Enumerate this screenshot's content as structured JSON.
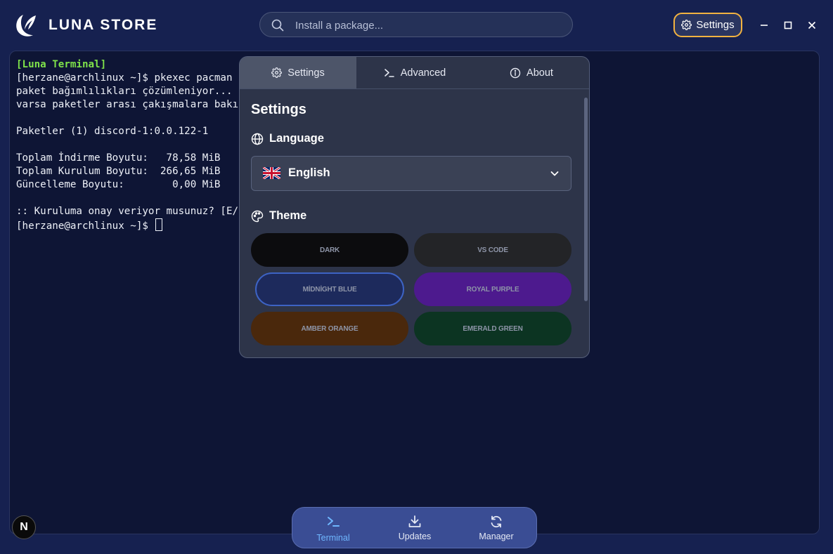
{
  "header": {
    "app_title": "LUNA STORE",
    "search_placeholder": "Install a package...",
    "settings_label": "Settings"
  },
  "terminal": {
    "lines": [
      {
        "text": "[Luna Terminal]",
        "highlight": true
      },
      {
        "text": "[herzane@archlinux ~]$ pkexec pacman -",
        "highlight": false
      },
      {
        "text": "paket bağımlılıkları çözümleniyor...",
        "highlight": false
      },
      {
        "text": "varsa paketler arası çakışmalara bakıl",
        "highlight": false
      },
      {
        "text": "",
        "highlight": false
      },
      {
        "text": "Paketler (1) discord-1:0.0.122-1",
        "highlight": false
      },
      {
        "text": "",
        "highlight": false
      },
      {
        "text": "Toplam İndirme Boyutu:   78,58 MiB",
        "highlight": false
      },
      {
        "text": "Toplam Kurulum Boyutu:  266,65 MiB",
        "highlight": false
      },
      {
        "text": "Güncelleme Boyutu:        0,00 MiB",
        "highlight": false
      },
      {
        "text": "",
        "highlight": false
      },
      {
        "text": ":: Kuruluma onay veriyor musunuz? [E/h",
        "highlight": false
      },
      {
        "text": "[herzane@archlinux ~]$ ",
        "highlight": false
      }
    ],
    "highlight_color": "#7fe24a"
  },
  "settings_panel": {
    "tabs": [
      {
        "label": "Settings",
        "icon": "gear-icon",
        "active": true
      },
      {
        "label": "Advanced",
        "icon": "terminal-prompt-icon",
        "active": false
      },
      {
        "label": "About",
        "icon": "info-icon",
        "active": false
      }
    ],
    "title": "Settings",
    "language_label": "Language",
    "language_value": "English",
    "language_flag": "uk-flag-icon",
    "theme_label": "Theme",
    "themes": [
      {
        "label": "DARK",
        "bg": "#0c0c0e",
        "border": "#0c0c0e"
      },
      {
        "label": "VS CODE",
        "bg": "#232427",
        "border": "#232427"
      },
      {
        "label": "MİDNİGHT BLUE",
        "bg": "#1d2a5c",
        "border": "#3d63c4",
        "selected": true
      },
      {
        "label": "ROYAL PURPLE",
        "bg": "#4d1a8e",
        "border": "#4d1a8e"
      },
      {
        "label": "AMBER ORANGE",
        "bg": "#4a280c",
        "border": "#4a280c"
      },
      {
        "label": "EMERALD GREEN",
        "bg": "#0c3422",
        "border": "#0c3422"
      }
    ]
  },
  "bottom_nav": [
    {
      "label": "Terminal",
      "icon": "terminal-icon",
      "active": true
    },
    {
      "label": "Updates",
      "icon": "download-icon",
      "active": false
    },
    {
      "label": "Manager",
      "icon": "refresh-icon",
      "active": false
    }
  ],
  "floating_button": {
    "label": "N"
  },
  "colors": {
    "accent": "#f3b340",
    "active_nav": "#6fb7ff",
    "background": "#162150"
  }
}
